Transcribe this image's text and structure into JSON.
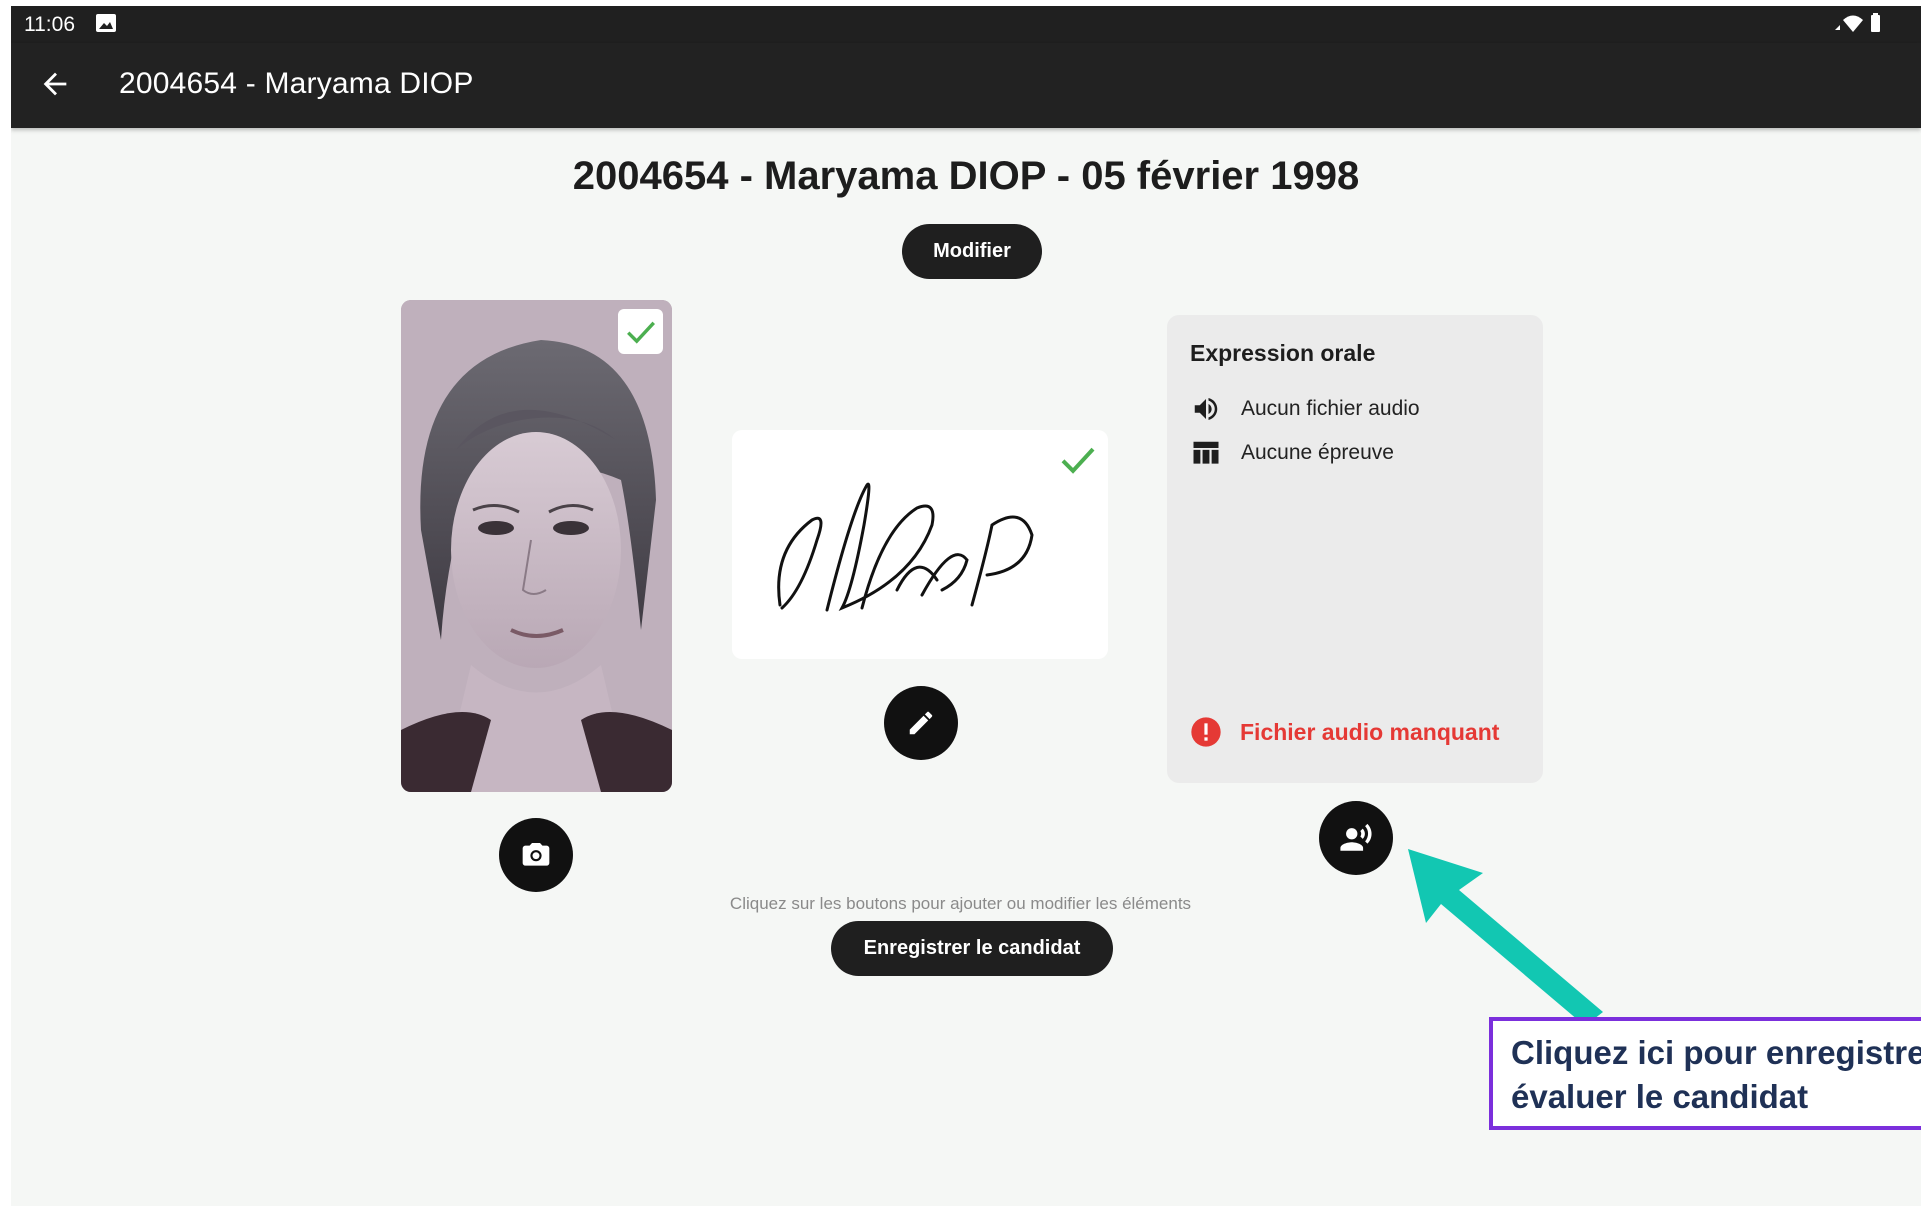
{
  "status_bar": {
    "time": "11:06",
    "icons": [
      "image-icon",
      "signal-icon",
      "wifi-icon",
      "battery-icon"
    ]
  },
  "app_bar": {
    "back_icon": "arrow-back-icon",
    "title": "2004654 - Maryama DIOP"
  },
  "page": {
    "heading": "2004654 - Maryama DIOP - 05 février 1998",
    "modifier_label": "Modifier",
    "hint": "Cliquez sur les boutons pour ajouter ou modifier les éléments",
    "save_label": "Enregistrer le candidat"
  },
  "photo": {
    "status_icon": "check-icon",
    "button_icon": "camera-icon"
  },
  "signature": {
    "status_icon": "check-icon",
    "button_icon": "pencil-icon"
  },
  "oral": {
    "title": "Expression orale",
    "audio_text": "Aucun fichier audio",
    "audio_icon": "volume-icon",
    "test_text": "Aucune épreuve",
    "test_icon": "table-icon",
    "warning_text": "Fichier audio manquant",
    "warning_icon": "error-icon",
    "button_icon": "record-voice-icon"
  },
  "annotation": {
    "callout_text": "Cliquez ici pour enregistrer\névaluer le candidat",
    "arrow_icon": "arrow-icon"
  },
  "colors": {
    "dark": "#1f1f1f",
    "background": "#f5f7f5",
    "success": "#4caf50",
    "error": "#e53935",
    "arrow": "#12c7b2",
    "callout_border": "#7b2fdc",
    "callout_text": "#1f3156"
  }
}
